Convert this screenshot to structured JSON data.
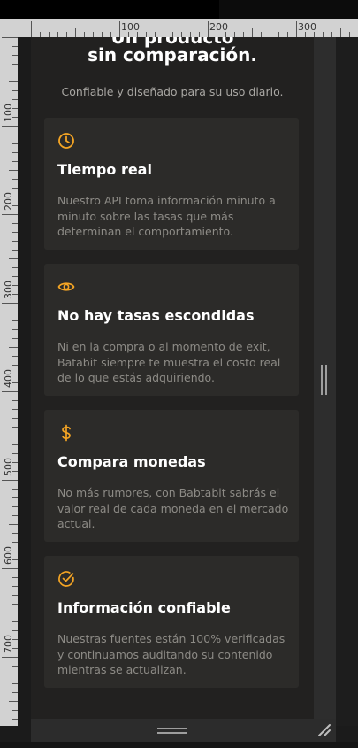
{
  "ruler": {
    "h_labels": [
      "100",
      "200",
      "300"
    ],
    "v_labels": [
      "100",
      "200",
      "300",
      "400",
      "500",
      "600",
      "700"
    ]
  },
  "hero": {
    "title_line1": "Un producto",
    "title_line2": "sin comparación.",
    "subtitle": "Confiable y diseñado para su uso diario."
  },
  "cards": [
    {
      "icon": "clock-icon",
      "title": "Tiempo real",
      "desc": "Nuestro API toma información minuto a minuto sobre las tasas que más determinan el comportamiento."
    },
    {
      "icon": "eye-icon",
      "title": "No hay tasas escondidas",
      "desc": "Ni en la compra o al momento de exit, Batabit siempre te muestra el costo real de lo que estás adquiriendo."
    },
    {
      "icon": "dollar-icon",
      "title": "Compara monedas",
      "desc": "No más rumores, con Babtabit sabrás el valor real de cada moneda en el mercado actual."
    },
    {
      "icon": "check-circle-icon",
      "title": "Información confiable",
      "desc": "Nuestras fuentes están 100% verificadas y continuamos auditando su contenido mientras se actualizan."
    }
  ],
  "colors": {
    "accent": "#f5a524",
    "card_bg": "#2c2b29",
    "page_bg": "#222120",
    "title": "#ffffff",
    "desc": "#8d8b86"
  }
}
